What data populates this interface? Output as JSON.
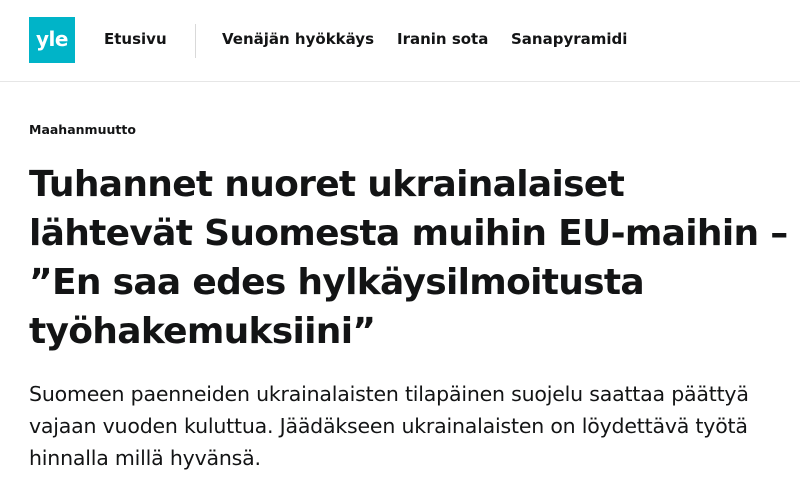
{
  "header": {
    "logo_text": "yle",
    "home_label": "Etusivu",
    "nav_items": [
      {
        "label": "Venäjän hyökkäys"
      },
      {
        "label": "Iranin sota"
      },
      {
        "label": "Sanapyramidi"
      }
    ]
  },
  "article": {
    "category": "Maahanmuutto",
    "headline": "Tuhannet nuoret ukrainalaiset lähtevät Suomesta muihin EU-maihin – ”En saa edes hylkäysilmoitusta työhakemuksiini”",
    "lead": "Suomeen paenneiden ukrainalaisten tilapäinen suojelu saattaa päättyä vajaan vuoden kuluttua. Jäädäkseen ukrainalaisten on löydettävä työtä hinnalla millä hyvänsä."
  },
  "colors": {
    "brand": "#00b4c8",
    "text": "#131415",
    "divider": "#d9d9d9"
  }
}
